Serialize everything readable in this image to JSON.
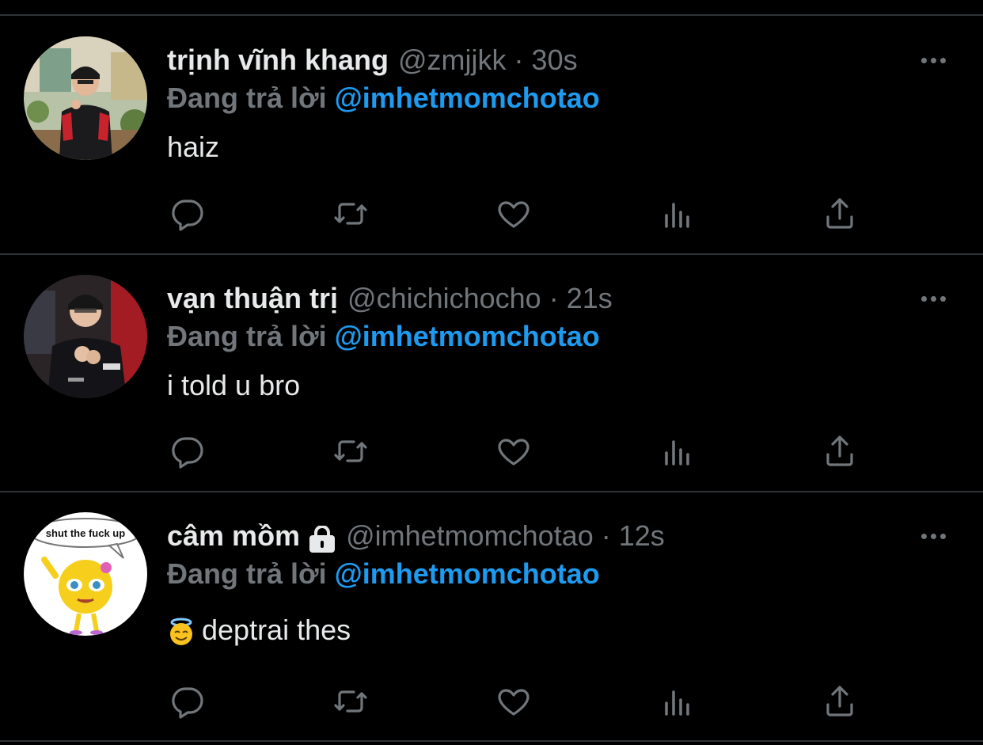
{
  "tweets": [
    {
      "name": "trịnh vĩnh khang",
      "handle": "@zmjjkk",
      "separator": "·",
      "time": "30s",
      "replying_prefix": "Đang trả lời",
      "replying_to": "@imhetmomchotao",
      "text": "haiz",
      "locked": false,
      "avatar": "avatar-khang"
    },
    {
      "name": "vạn thuận trị",
      "handle": "@chichichocho",
      "separator": "·",
      "time": "21s",
      "replying_prefix": "Đang trả lời",
      "replying_to": "@imhetmomchotao",
      "text": "i told u bro",
      "locked": false,
      "avatar": "avatar-tri"
    },
    {
      "name": "câm mồm",
      "handle": "@imhetmomchotao",
      "separator": "·",
      "time": "12s",
      "replying_prefix": "Đang trả lời",
      "replying_to": "@imhetmomchotao",
      "text": "deptrai thes",
      "emoji": "smiling-face-with-halo",
      "locked": true,
      "avatar": "avatar-meme",
      "avatar_caption": "shut the fuck up"
    }
  ],
  "icons": {
    "reply": "reply-icon",
    "retweet": "retweet-icon",
    "like": "like-icon",
    "analytics": "analytics-icon",
    "share": "share-icon",
    "more": "more-icon",
    "lock": "lock-icon"
  },
  "colors": {
    "background": "#000000",
    "text": "#e7e9ea",
    "secondary": "#71767b",
    "accent": "#1d9bf0",
    "divider": "#2f3336"
  }
}
